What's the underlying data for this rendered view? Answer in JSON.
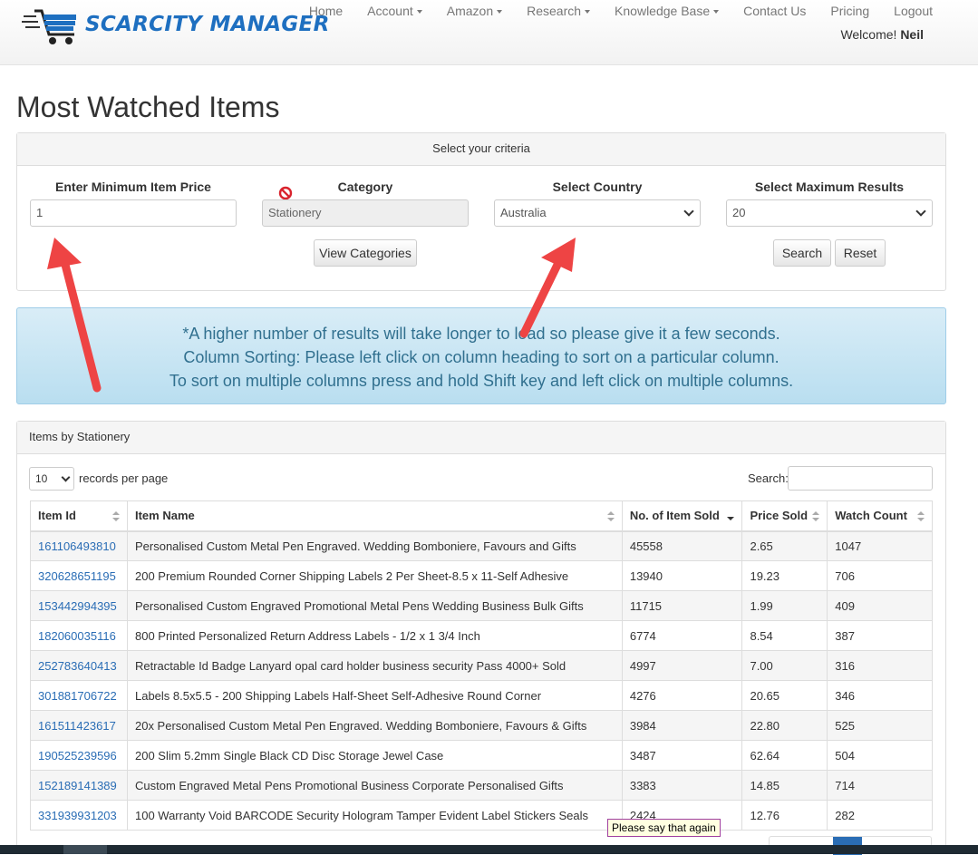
{
  "brand": {
    "name": "SCARCITY MANAGER"
  },
  "nav": {
    "items": [
      {
        "label": "Home",
        "dropdown": false
      },
      {
        "label": "Account",
        "dropdown": true
      },
      {
        "label": "Amazon",
        "dropdown": true
      },
      {
        "label": "Research",
        "dropdown": true
      },
      {
        "label": "Knowledge Base",
        "dropdown": true
      },
      {
        "label": "Contact Us",
        "dropdown": false
      },
      {
        "label": "Pricing",
        "dropdown": false
      },
      {
        "label": "Logout",
        "dropdown": false
      }
    ],
    "welcome_prefix": "Welcome!",
    "welcome_user": "Neil"
  },
  "page": {
    "title": "Most Watched Items"
  },
  "criteria": {
    "heading": "Select your criteria",
    "min_price_label": "Enter Minimum Item Price",
    "min_price_value": "1",
    "category_label": "Category",
    "category_value": "Stationery",
    "view_categories_label": "View Categories",
    "country_label": "Select Country",
    "country_value": "Australia",
    "max_results_label": "Select Maximum Results",
    "max_results_value": "20",
    "search_label": "Search",
    "reset_label": "Reset"
  },
  "info": {
    "line1": "*A higher number of results will take longer to load so please give it a few seconds.",
    "line2": "Column Sorting: Please left click on column heading to sort on a particular column.",
    "line3": "To sort on multiple columns press and hold Shift key and left click on multiple columns."
  },
  "items_panel": {
    "heading": "Items by Stationery",
    "page_length": "10",
    "records_per_page": "records per page",
    "search_label": "Search:",
    "columns": [
      "Item Id",
      "Item Name",
      "No. of Item Sold",
      "Price Sold",
      "Watch Count"
    ],
    "rows": [
      [
        "161106493810",
        "Personalised Custom Metal Pen Engraved. Wedding Bomboniere, Favours and Gifts",
        "45558",
        "2.65",
        "1047"
      ],
      [
        "320628651195",
        "200 Premium Rounded Corner Shipping Labels 2 Per Sheet-8.5 x 11-Self Adhesive",
        "13940",
        "19.23",
        "706"
      ],
      [
        "153442994395",
        "Personalised Custom Engraved Promotional Metal Pens Wedding Business Bulk Gifts",
        "11715",
        "1.99",
        "409"
      ],
      [
        "182060035116",
        "800 Printed Personalized Return Address Labels - 1/2 x 1 3/4 Inch",
        "6774",
        "8.54",
        "387"
      ],
      [
        "252783640413",
        "Retractable Id Badge Lanyard opal card holder business security Pass 4000+ Sold",
        "4997",
        "7.00",
        "316"
      ],
      [
        "301881706722",
        "Labels 8.5x5.5 - 200 Shipping Labels Half-Sheet Self-Adhesive Round Corner",
        "4276",
        "20.65",
        "346"
      ],
      [
        "161511423617",
        "20x Personalised Custom Metal Pen Engraved. Wedding Bomboniere, Favours & Gifts",
        "3984",
        "22.80",
        "525"
      ],
      [
        "190525239596",
        "200 Slim 5.2mm Single Black CD Disc Storage Jewel Case",
        "3487",
        "62.64",
        "504"
      ],
      [
        "152189141389",
        "Custom Engraved Metal Pens Promotional Business Corporate Personalised Gifts",
        "3383",
        "14.85",
        "714"
      ],
      [
        "331939931203",
        "100 Warranty Void BARCODE Security Hologram Tamper Evident Label Stickers Seals",
        "2424",
        "12.76",
        "282"
      ]
    ]
  },
  "tooltip": {
    "text": "Please say that again"
  },
  "colors": {
    "brand_blue": "#1e6fc0",
    "link_blue": "#2a6db5",
    "info_text": "#31708f",
    "arrow_red": "#ee4444"
  }
}
